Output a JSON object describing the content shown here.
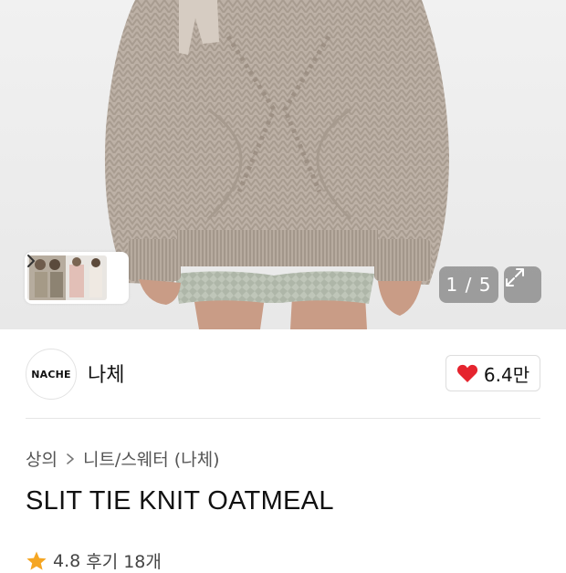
{
  "gallery": {
    "counter": "1 / 5",
    "thumb_chevron_icon": "chevron-right-icon",
    "expand_icon": "expand-icon"
  },
  "brand": {
    "logo_text": "NACHE",
    "name": "나체",
    "likes_label": "6.4만",
    "like_icon": "heart-icon",
    "like_color": "#e5242e"
  },
  "product": {
    "breadcrumb": [
      "상의",
      "니트/스웨터 (나체)"
    ],
    "title": "SLIT TIE KNIT OATMEAL",
    "rating": "4.8",
    "reviews_label": "후기 18개",
    "star_color": "#f5a623"
  }
}
